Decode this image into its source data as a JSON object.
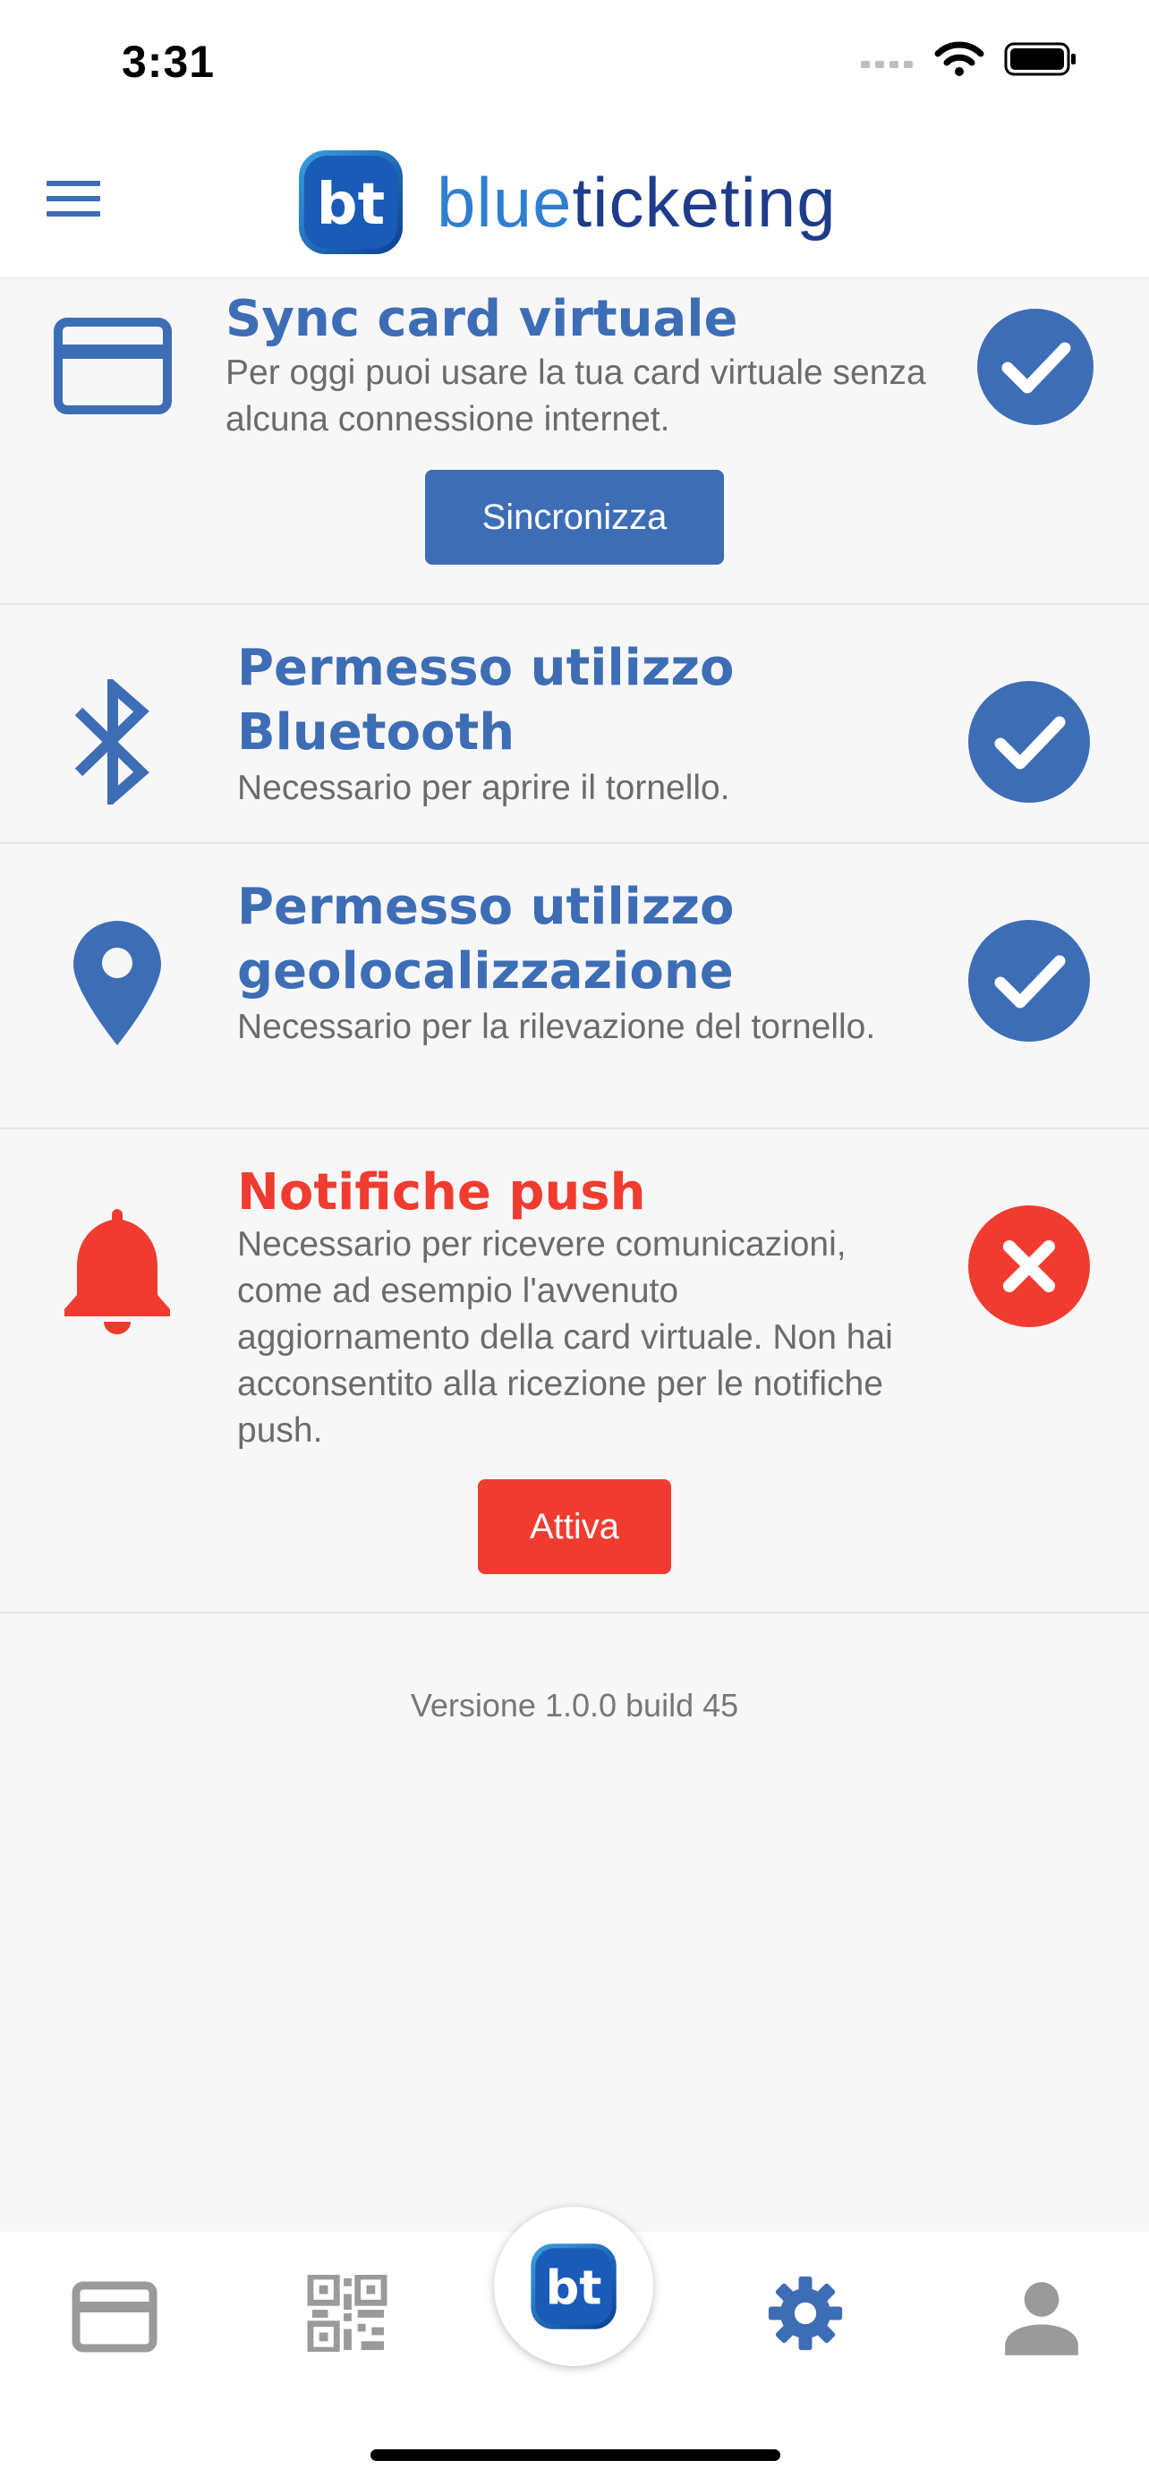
{
  "status_bar": {
    "time": "3:31"
  },
  "header": {
    "logo_text_primary": "blue",
    "logo_text_secondary": "ticketing",
    "logo_mark": "bt"
  },
  "rows": [
    {
      "title": "Sync card virtuale",
      "description": "Per oggi puoi usare la tua card virtuale senza alcuna connessione internet.",
      "status": "ok",
      "button": "Sincronizza",
      "icon": "credit-card-icon"
    },
    {
      "title": "Permesso utilizzo Bluetooth",
      "description": "Necessario per aprire il tornello.",
      "status": "ok",
      "icon": "bluetooth-icon"
    },
    {
      "title": "Permesso utilizzo geolocalizzazione",
      "description": "Necessario per la rilevazione del tornello.",
      "status": "ok",
      "icon": "location-pin-icon"
    },
    {
      "title": "Notifiche push",
      "description": "Necessario per ricevere comunicazioni, come ad esempio l'avvenuto aggiornamento della card virtuale. Non hai acconsentito alla ricezione per le notifiche push.",
      "status": "error",
      "button": "Attiva",
      "icon": "bell-icon"
    }
  ],
  "footer": {
    "version": "Versione 1.0.0 build 45"
  },
  "tab_bar": {
    "items": [
      "card-icon",
      "qr-code-icon",
      "bt-logo",
      "gear-icon",
      "person-icon"
    ],
    "active": "gear-icon"
  },
  "colors": {
    "primary": "#3d6db5",
    "error": "#f03c30",
    "muted": "#6b6b6b",
    "tab_inactive": "#9a9a9a"
  }
}
